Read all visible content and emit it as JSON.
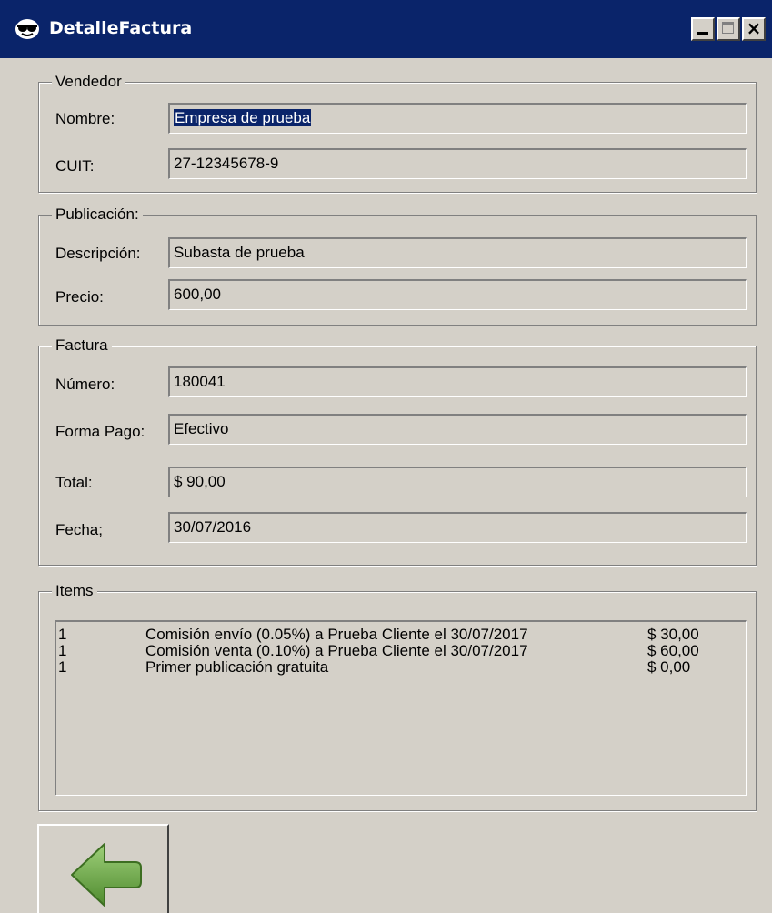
{
  "window": {
    "title": "DetalleFactura"
  },
  "vendedor": {
    "legend": "Vendedor",
    "nombre_label": "Nombre:",
    "nombre_value": "Empresa de prueba",
    "cuit_label": "CUIT:",
    "cuit_value": "27-12345678-9"
  },
  "publicacion": {
    "legend": "Publicación:",
    "descripcion_label": "Descripción:",
    "descripcion_value": "Subasta de prueba",
    "precio_label": "Precio:",
    "precio_value": "600,00"
  },
  "factura": {
    "legend": "Factura",
    "numero_label": "Número:",
    "numero_value": "180041",
    "forma_pago_label": "Forma Pago:",
    "forma_pago_value": "Efectivo",
    "total_label": "Total:",
    "total_value": "$ 90,00",
    "fecha_label": "Fecha;",
    "fecha_value": "30/07/2016"
  },
  "items": {
    "legend": "Items",
    "rows": [
      {
        "qty": "1",
        "desc": "Comisión envío (0.05%) a Prueba Cliente el 30/07/2017",
        "amount": "$ 30,00"
      },
      {
        "qty": "1",
        "desc": "Comisión venta (0.10%) a Prueba Cliente el 30/07/2017",
        "amount": "$ 60,00"
      },
      {
        "qty": "1",
        "desc": "Primer publicación gratuita",
        "amount": "$ 0,00"
      }
    ]
  },
  "icons": {
    "app": "sunglasses-face-icon",
    "back": "back-arrow-icon"
  },
  "colors": {
    "titlebar": "#0a246a",
    "window_bg": "#d4d0c8",
    "arrow_green": "#6aa84f"
  }
}
